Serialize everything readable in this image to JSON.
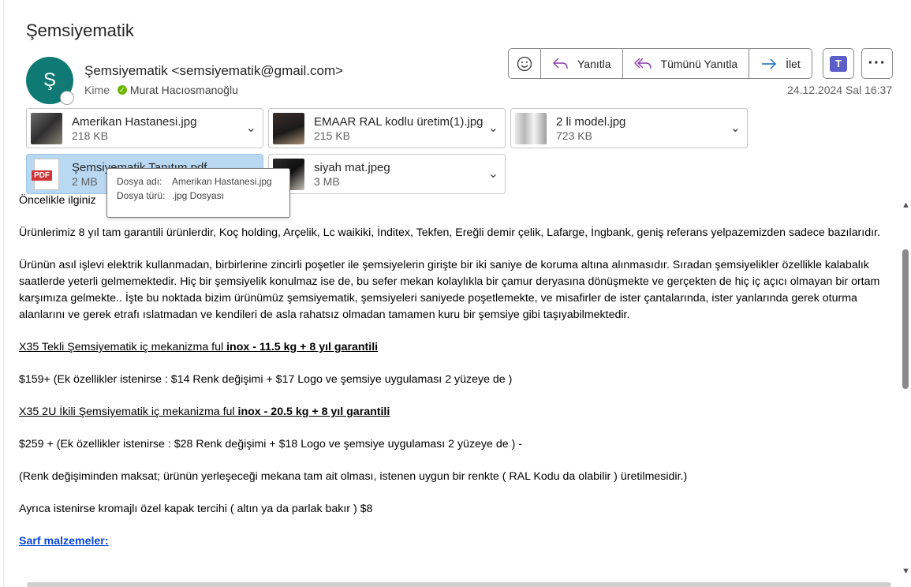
{
  "subject": "Şemsiyematik",
  "sender": {
    "avatar_initial": "Ş",
    "display": "Şemsiyematik <semsiyematik@gmail.com>",
    "to_label": "Kime",
    "recipient": "Murat Hacıosmanoğlu"
  },
  "actions": {
    "emoji_icon": "emoji-icon",
    "reply": "Yanıtla",
    "reply_all": "Tümünü Yanıtla",
    "forward": "İlet"
  },
  "date": "24.12.2024 Sal 16:37",
  "attachments": [
    {
      "name": "Amerikan Hastanesi.jpg",
      "size": "218 KB"
    },
    {
      "name": "EMAAR RAL kodlu üretim(1).jpg",
      "size": "215 KB"
    },
    {
      "name": "2 li model.jpg",
      "size": "723 KB"
    },
    {
      "name": "Şemsiyematik Tanıtım.pdf",
      "size": "2 MB",
      "type_label": "PDF"
    },
    {
      "name": "siyah mat.jpeg",
      "size": "3 MB"
    }
  ],
  "tooltip": {
    "name_key": "Dosya adı:",
    "name_val": "Amerikan Hastanesi.jpg",
    "type_key": "Dosya türü:",
    "type_val": ".jpg Dosyası"
  },
  "body": {
    "intro": "Öncelikle ilginiz",
    "p1": "Ürünlerimiz 8 yıl tam garantili ürünlerdir,  Koç holding, Arçelik, Lc waikiki, İnditex, Tekfen, Ereğli demir çelik, Lafarge, İngbank, geniş referans yelpazemizden sadece bazılarıdır.",
    "p2": "Ürünün asıl işlevi elektrik kullanmadan, birbirlerine zincirli poşetler ile şemsiyelerin girişte bir iki saniye de koruma altına alınmasıdır. Sıradan şemsiyelikler özellikle kalabalık saatlerde yeterli gelmemektedir. Hiç bir şemsiyelik konulmaz ise de, bu sefer mekan kolaylıkla bir çamur deryasına dönüşmekte ve gerçekten de hiç iç açıcı olmayan bir ortam karşımıza gelmekte.. İşte bu noktada bizim ürünümüz şemsiyematik, şemsiyeleri saniyede poşetlemekte, ve misafirler de  ister çantalarında, ister yanlarında gerek oturma alanlarını ve gerek etrafı ıslatmadan ve kendileri de asla rahatsız olmadan tamamen kuru bir şemsiye gibi taşıyabilmektedir.",
    "h1_plain": "X35 Tekli Şemsiyematik  iç mekanizma ful ",
    "h1_bold": "inox - 11.5 kg +  8 yıl garantili",
    "price1": "$159+  (Ek özellikler istenirse :  $14 Renk değişimi + $17 Logo ve şemsiye uygulaması 2 yüzeye de )",
    "h2_plain": "X35 2U İkili Şemsiyematik   iç mekanizma ful ",
    "h2_bold": "inox - 20.5 kg +  8 yıl garantili",
    "price2": "$259 + (Ek özellikler istenirse : $28 Renk değişimi + $18 Logo ve şemsiye uygulaması 2 yüzeye de )  -",
    "note": "(Renk değişiminden maksat; ürünün yerleşeceği mekana tam ait olması, istenen uygun bir renkte ( RAL Kodu da olabilir ) üretilmesidir.)",
    "extra": "Ayrıca istenirse kromajlı özel kapak tercihi ( altın ya da parlak bakır )  $8",
    "supplies": "Sarf malzemeler:"
  }
}
